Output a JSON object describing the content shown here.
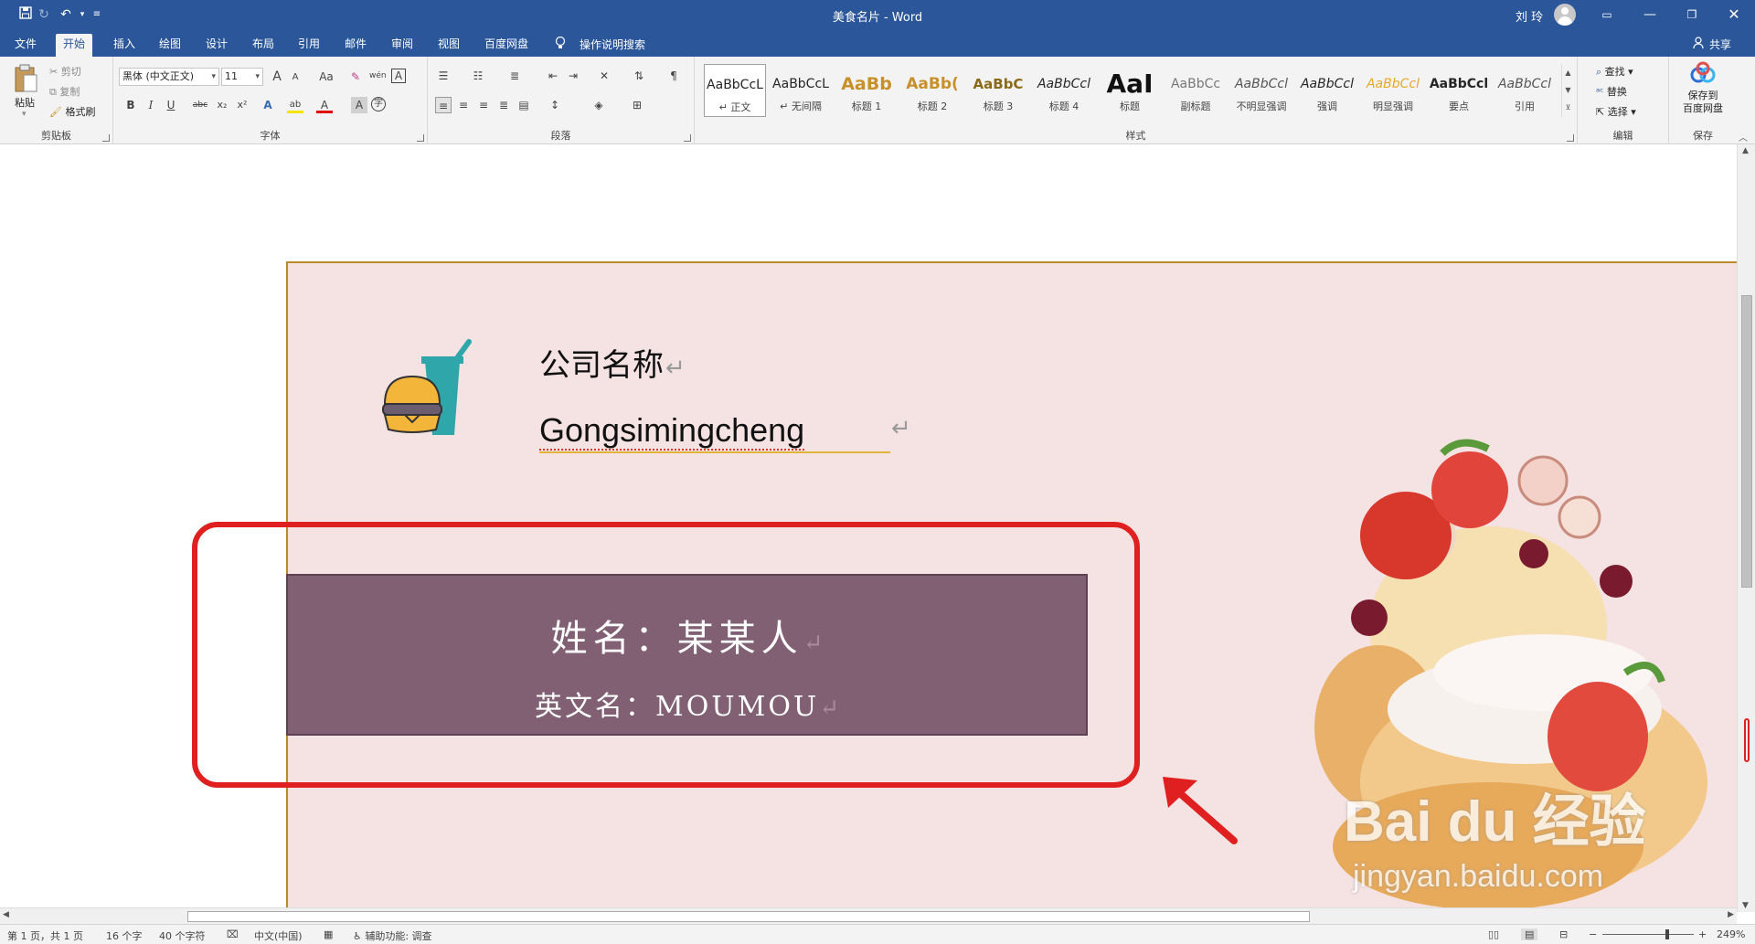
{
  "title_bar": {
    "document_title": "美食名片  -  Word",
    "user_name": "刘 玲",
    "save_icon": "save-icon",
    "undo_icon": "undo-icon",
    "redo_icon": "redo-icon",
    "customize_icon": "customize-quick-access-icon",
    "ribbon_display_icon": "ribbon-display-options-icon",
    "minimize_icon": "minimize-icon",
    "restore_icon": "restore-icon",
    "close_icon": "close-icon"
  },
  "tabs": [
    {
      "label": "文件"
    },
    {
      "label": "开始",
      "active": true
    },
    {
      "label": "插入"
    },
    {
      "label": "绘图"
    },
    {
      "label": "设计"
    },
    {
      "label": "布局"
    },
    {
      "label": "引用"
    },
    {
      "label": "邮件"
    },
    {
      "label": "审阅"
    },
    {
      "label": "视图"
    },
    {
      "label": "百度网盘"
    }
  ],
  "tell_me": "操作说明搜索",
  "share": "共享",
  "ribbon": {
    "clipboard": {
      "label": "剪贴板",
      "paste": "粘贴",
      "cut": "剪切",
      "copy": "复制",
      "format_painter": "格式刷"
    },
    "font": {
      "label": "字体",
      "font_name": "黑体 (中文正文)",
      "font_size": "11",
      "grow": "A",
      "shrink": "A",
      "change_case": "Aa",
      "bold": "B",
      "italic": "I",
      "underline": "U",
      "strikethrough": "abc",
      "subscript": "x₂",
      "superscript": "x²",
      "text_effects": "A",
      "highlight": "ab",
      "font_color": "A",
      "char_shading": "A",
      "phonetic": "wén",
      "char_border": "A",
      "enclose": "字"
    },
    "paragraph": {
      "label": "段落"
    },
    "styles": {
      "label": "样式",
      "items": [
        {
          "preview": "AaBbCcL",
          "name": "↵ 正文"
        },
        {
          "preview": "AaBbCcL",
          "name": "↵ 无间隔"
        },
        {
          "preview": "AaBb",
          "name": "标题 1"
        },
        {
          "preview": "AaBb(",
          "name": "标题 2"
        },
        {
          "preview": "AaBbC",
          "name": "标题 3"
        },
        {
          "preview": "AaBbCcl",
          "name": "标题 4"
        },
        {
          "preview": "AaI",
          "name": "标题"
        },
        {
          "preview": "AaBbCc",
          "name": "副标题"
        },
        {
          "preview": "AaBbCcl",
          "name": "不明显强调"
        },
        {
          "preview": "AaBbCcl",
          "name": "强调"
        },
        {
          "preview": "AaBbCcl",
          "name": "明显强调"
        },
        {
          "preview": "AaBbCcl",
          "name": "要点"
        },
        {
          "preview": "AaBbCcl",
          "name": "引用"
        }
      ]
    },
    "editing": {
      "label": "编辑",
      "find": "查找",
      "replace": "替换",
      "select": "选择"
    },
    "save": {
      "label": "保存",
      "save_to_line1": "保存到",
      "save_to_line2": "百度网盘"
    }
  },
  "document": {
    "company_name": "公司名称",
    "company_pinyin": "Gongsimingcheng",
    "person_name": "姓名：某某人",
    "english_name": "英文名：MOUMOU",
    "paragraph_mark": "↵",
    "watermark_main": "Bai du 经验",
    "watermark_sub": "jingyan.baidu.com"
  },
  "status_bar": {
    "page": "第 1 页，共 1 页",
    "words": "16 个字",
    "chars": "40 个字符",
    "language": "中文(中国)",
    "accessibility": "辅助功能: 调查",
    "zoom_minus": "−",
    "zoom_plus": "+",
    "zoom": "249%"
  },
  "colors": {
    "word_blue": "#2b579a",
    "page_background": "#f5e2e2",
    "name_box": "#826074",
    "highlight_red": "#e02020",
    "page_border_gold": "#bb8a2a"
  }
}
